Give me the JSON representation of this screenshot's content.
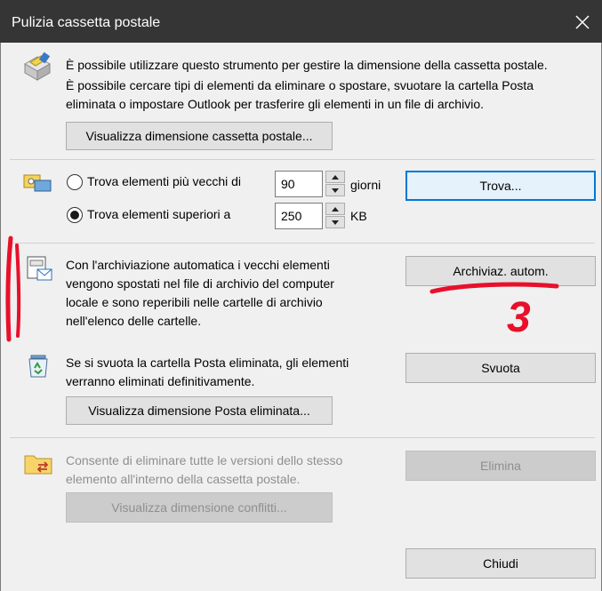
{
  "window": {
    "title": "Pulizia cassetta postale"
  },
  "intro": {
    "line1": "È possibile utilizzare questo strumento per gestire la dimensione della cassetta postale.",
    "line2": "È possibile cercare tipi di elementi da eliminare o spostare, svuotare la cartella Posta",
    "line3": "eliminata o impostare Outlook per trasferire gli elementi in un file di archivio.",
    "view_size_button": "Visualizza dimensione cassetta postale..."
  },
  "find": {
    "older_label": "Trova elementi più vecchi di",
    "older_value": "90",
    "older_unit": "giorni",
    "larger_label": "Trova elementi superiori a",
    "larger_value": "250",
    "larger_unit": "KB",
    "find_button": "Trova..."
  },
  "autoarchive": {
    "line1": "Con l'archiviazione automatica i vecchi elementi",
    "line2": "vengono spostati nel file di archivio del computer",
    "line3": "locale e sono reperibili nelle cartelle di archivio",
    "line4": "nell'elenco delle cartelle.",
    "button": "Archiviaz. autom.",
    "annotation_number": "3"
  },
  "deleted": {
    "line1": "Se si svuota la cartella Posta eliminata, gli elementi",
    "line2": "verranno eliminati definitivamente.",
    "empty_button": "Svuota",
    "view_size_button": "Visualizza dimensione Posta eliminata..."
  },
  "conflicts": {
    "line1": "Consente di eliminare tutte le versioni dello stesso",
    "line2": "elemento all'interno della cassetta postale.",
    "delete_button": "Elimina",
    "view_size_button": "Visualizza dimensione conflitti..."
  },
  "footer": {
    "close_button": "Chiudi"
  },
  "colors": {
    "annotation_red": "#e8102a",
    "focus_blue": "#0078d7",
    "title_bar": "#353535"
  }
}
